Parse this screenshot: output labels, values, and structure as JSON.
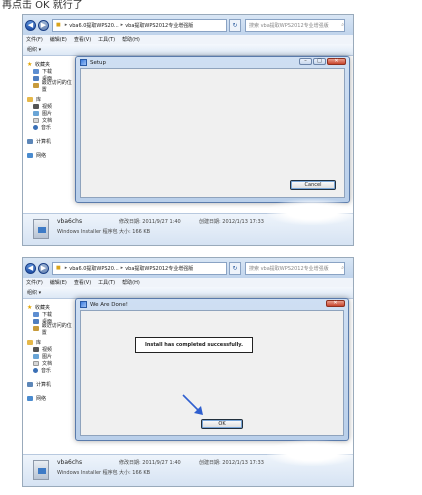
{
  "caption": "再点击 OK 就行了",
  "explorer": {
    "breadcrumb": [
      "vba6.0提取WPS20...",
      "vba提取WPS2012专业增强版"
    ],
    "search_placeholder": "搜索 vba提取WPS2012专业增强版",
    "menu": [
      "文件(F)",
      "编辑(E)",
      "查看(V)",
      "工具(T)",
      "帮助(H)"
    ],
    "organize": "组织 ▾",
    "sidebar": {
      "favorites": "收藏夹",
      "favorites_items": [
        "下载",
        "桌面",
        "最近访问的位置"
      ],
      "library": "库",
      "library_items": [
        "视频",
        "图片",
        "文档",
        "音乐"
      ],
      "computer": "计算机",
      "network": "网络"
    },
    "details": {
      "name": "vba6chs",
      "type": "Windows Installer 程序包",
      "modified_label": "修改日期: 2011/9/27 1:40",
      "created_label": "创建日期: 2012/1/13 17:33",
      "size_label": "大小: 166 KB"
    }
  },
  "setup_dialog": {
    "title": "Setup",
    "cancel": "Cancel"
  },
  "done_dialog": {
    "title": "We Are Done!",
    "message": "Install has completed successfully.",
    "ok": "OK"
  },
  "colors": {
    "accent": "#2a6fd6",
    "arrow": "#2f5fcf"
  }
}
